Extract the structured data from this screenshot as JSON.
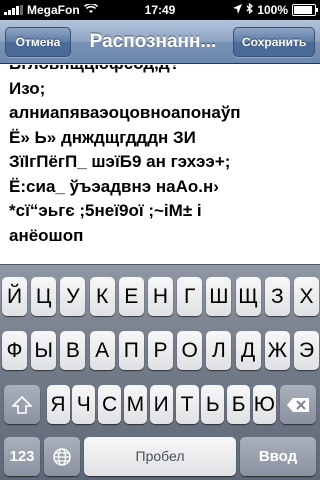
{
  "status_bar": {
    "carrier": "MegaFon",
    "time": "17:49",
    "battery": "100%",
    "battery_level": 1.0
  },
  "nav": {
    "cancel": "Отмена",
    "title": "Распознанн...",
    "save": "Сохранить"
  },
  "text": {
    "lines": [
      "Бгловнщцюфсод,д?",
      "Изо;",
      "алниапяваэоцовноапонаўп",
      "Ё» Ь» днждщгдддн ЗИ",
      "ЗїІгПёгП_ шэїБ9 ан гэхээ+;",
      "Ё:сиа_ ўъэадвнэ наАо.н›",
      "*сї“эьгє ;5неї9ої ;~іМ± і",
      "анёошоп"
    ]
  },
  "keyboard": {
    "row1": [
      "Й",
      "Ц",
      "У",
      "К",
      "Е",
      "Н",
      "Г",
      "Ш",
      "Щ",
      "З",
      "Х"
    ],
    "row2": [
      "Ф",
      "Ы",
      "В",
      "А",
      "П",
      "Р",
      "О",
      "Л",
      "Д",
      "Ж",
      "Э"
    ],
    "row3": [
      "Я",
      "Ч",
      "С",
      "М",
      "И",
      "Т",
      "Ь",
      "Б",
      "Ю"
    ],
    "numbers_key": "123",
    "space_key": "Пробел",
    "enter_key": "Ввод",
    "icons": {
      "shift": "shift-icon",
      "backspace": "backspace-icon",
      "globe": "globe-icon"
    }
  }
}
